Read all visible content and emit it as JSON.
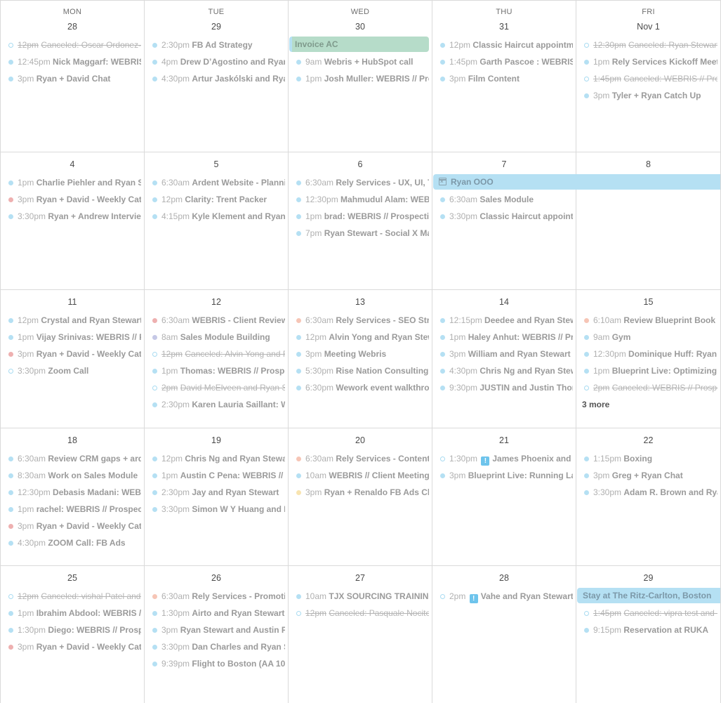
{
  "calendar": {
    "weekdays": [
      "MON",
      "TUE",
      "WED",
      "THU",
      "FRI"
    ],
    "colors": {
      "default_event": "#b5e0f3",
      "red_event": "#eeb0b0",
      "salmon_event": "#f6c5b6",
      "purple_event": "#c5c8e6",
      "yellow_event": "#f8e4b0",
      "allday_green": "#b6dcc9",
      "allday_blue": "#b5e0f3"
    },
    "weeks": [
      {
        "days": [
          {
            "date": "28",
            "events": [
              {
                "time": "12pm",
                "title": "Canceled: Oscar Ordonez-",
                "color": "hollow",
                "canceled": true
              },
              {
                "time": "12:45pm",
                "title": "Nick Maggarf: WEBRIS",
                "color": "blue"
              },
              {
                "time": "3pm",
                "title": "Ryan + David Chat",
                "color": "blue"
              }
            ]
          },
          {
            "date": "29",
            "events": [
              {
                "time": "2:30pm",
                "title": "FB Ad Strategy",
                "color": "blue"
              },
              {
                "time": "4pm",
                "title": "Drew D’Agostino and Ryan Stewart",
                "color": "blue"
              },
              {
                "time": "4:30pm",
                "title": "Artur Jaskólski and Ryan Stewart",
                "color": "blue"
              }
            ]
          },
          {
            "date": "30",
            "allday": {
              "title": "Invoice AC",
              "style": "green"
            },
            "events": [
              {
                "time": "9am",
                "title": "Webris + HubSpot call",
                "color": "blue"
              },
              {
                "time": "1pm",
                "title": "Josh Muller: WEBRIS // Prospective",
                "color": "blue"
              }
            ]
          },
          {
            "date": "31",
            "events": [
              {
                "time": "12pm",
                "title": "Classic Haircut appointment",
                "color": "blue"
              },
              {
                "time": "1:45pm",
                "title": "Garth Pascoe : WEBRIS // Prospective",
                "color": "blue"
              },
              {
                "time": "3pm",
                "title": "Film Content",
                "color": "blue"
              }
            ]
          },
          {
            "date": "Nov 1",
            "events": [
              {
                "time": "12:30pm",
                "title": "Canceled: Ryan Stewart",
                "color": "hollow",
                "canceled": true
              },
              {
                "time": "1pm",
                "title": "Rely Services Kickoff Meeting",
                "color": "blue"
              },
              {
                "time": "1:45pm",
                "title": "Canceled: WEBRIS // Prospective",
                "color": "hollow",
                "canceled": true
              },
              {
                "time": "3pm",
                "title": "Tyler + Ryan Catch Up",
                "color": "blue"
              }
            ]
          }
        ]
      },
      {
        "days": [
          {
            "date": "4",
            "events": [
              {
                "time": "1pm",
                "title": "Charlie Piehler and Ryan Stewart",
                "color": "blue"
              },
              {
                "time": "3pm",
                "title": "Ryan + David - Weekly Catch Up",
                "color": "red"
              },
              {
                "time": "3:30pm",
                "title": "Ryan + Andrew Interview",
                "color": "blue"
              }
            ]
          },
          {
            "date": "5",
            "events": [
              {
                "time": "6:30am",
                "title": "Ardent Website - Planning",
                "color": "blue"
              },
              {
                "time": "12pm",
                "title": "Clarity: Trent Packer",
                "color": "blue"
              },
              {
                "time": "4:15pm",
                "title": "Kyle Klement and Ryan Stewart",
                "color": "blue"
              }
            ]
          },
          {
            "date": "6",
            "events": [
              {
                "time": "6:30am",
                "title": "Rely Services - UX, UI, Tech",
                "color": "blue"
              },
              {
                "time": "12:30pm",
                "title": "Mahmudul Alam: WEBRIS",
                "color": "blue"
              },
              {
                "time": "1pm",
                "title": "brad: WEBRIS // Prospective",
                "color": "blue"
              },
              {
                "time": "7pm",
                "title": "Ryan Stewart - Social X Marketing",
                "color": "blue"
              }
            ]
          },
          {
            "date": "7",
            "allday_span": {
              "title": "Ryan OOO",
              "icon": "calendar-x-icon",
              "style": "blue"
            },
            "events": [
              {
                "time": "6:30am",
                "title": "Sales Module",
                "color": "blue"
              },
              {
                "time": "3:30pm",
                "title": "Classic Haircut appointment",
                "color": "blue"
              }
            ]
          },
          {
            "date": "8",
            "events": []
          }
        ]
      },
      {
        "days": [
          {
            "date": "11",
            "events": [
              {
                "time": "12pm",
                "title": "Crystal and Ryan Stewart",
                "color": "blue"
              },
              {
                "time": "1pm",
                "title": "Vijay Srinivas: WEBRIS // Prospective",
                "color": "blue"
              },
              {
                "time": "3pm",
                "title": "Ryan + David - Weekly Catch Up",
                "color": "red"
              },
              {
                "time": "3:30pm",
                "title": "Zoom Call",
                "color": "hollow"
              }
            ]
          },
          {
            "date": "12",
            "events": [
              {
                "time": "6:30am",
                "title": "WEBRIS - Client Reviews",
                "color": "red"
              },
              {
                "time": "8am",
                "title": "Sales Module Building",
                "color": "purple"
              },
              {
                "time": "12pm",
                "title": "Canceled: Alvin Yong and Ryan Stewart",
                "color": "hollow",
                "canceled": true
              },
              {
                "time": "1pm",
                "title": "Thomas: WEBRIS // Prospective",
                "color": "blue"
              },
              {
                "time": "2pm",
                "title": "David McElveen and Ryan Stewart",
                "color": "hollow",
                "canceled": true
              },
              {
                "time": "2:30pm",
                "title": "Karen Lauria Saillant: WEBRIS",
                "color": "blue"
              }
            ]
          },
          {
            "date": "13",
            "events": [
              {
                "time": "6:30am",
                "title": "Rely Services - SEO Strategy",
                "color": "salmon"
              },
              {
                "time": "12pm",
                "title": "Alvin Yong and Ryan Stewart",
                "color": "blue"
              },
              {
                "time": "3pm",
                "title": "Meeting Webris",
                "color": "blue"
              },
              {
                "time": "5:30pm",
                "title": "Rise Nation Consulting",
                "color": "blue"
              },
              {
                "time": "6:30pm",
                "title": "Wework event walkthrough",
                "color": "blue"
              }
            ]
          },
          {
            "date": "14",
            "events": [
              {
                "time": "12:15pm",
                "title": "Deedee and Ryan Stewart",
                "color": "blue"
              },
              {
                "time": "1pm",
                "title": "Haley Anhut: WEBRIS // Prospective",
                "color": "blue"
              },
              {
                "time": "3pm",
                "title": "William and Ryan Stewart",
                "color": "blue"
              },
              {
                "time": "4:30pm",
                "title": "Chris Ng and Ryan Stewart",
                "color": "blue"
              },
              {
                "time": "9:30pm",
                "title": "JUSTIN and Justin Thomas",
                "color": "blue"
              }
            ]
          },
          {
            "date": "15",
            "more": "3 more",
            "events": [
              {
                "time": "6:10am",
                "title": "Review Blueprint Book",
                "color": "salmon"
              },
              {
                "time": "9am",
                "title": "Gym",
                "color": "blue"
              },
              {
                "time": "12:30pm",
                "title": "Dominique Huff: Ryan Stewart",
                "color": "blue"
              },
              {
                "time": "1pm",
                "title": "Blueprint Live: Optimizing Ins",
                "color": "blue"
              },
              {
                "time": "2pm",
                "title": "Canceled: WEBRIS // Prospective",
                "color": "hollow",
                "canceled": true
              }
            ]
          }
        ]
      },
      {
        "days": [
          {
            "date": "18",
            "events": [
              {
                "time": "6:30am",
                "title": "Review CRM gaps + ardent",
                "color": "blue"
              },
              {
                "time": "8:30am",
                "title": "Work on Sales Module",
                "color": "blue"
              },
              {
                "time": "12:30pm",
                "title": "Debasis Madani: WEBRIS",
                "color": "blue"
              },
              {
                "time": "1pm",
                "title": "rachel: WEBRIS // Prospective",
                "color": "blue"
              },
              {
                "time": "3pm",
                "title": "Ryan + David - Weekly Catch Up",
                "color": "red"
              },
              {
                "time": "4:30pm",
                "title": "ZOOM Call: FB Ads",
                "color": "blue"
              }
            ]
          },
          {
            "date": "19",
            "events": [
              {
                "time": "12pm",
                "title": "Chris Ng and Ryan Stewart",
                "color": "blue"
              },
              {
                "time": "1pm",
                "title": "Austin C Pena: WEBRIS // Prospective",
                "color": "blue"
              },
              {
                "time": "2:30pm",
                "title": "Jay and Ryan Stewart",
                "color": "blue"
              },
              {
                "time": "3:30pm",
                "title": "Simon W Y Huang and Ryan Stewart",
                "color": "blue"
              }
            ]
          },
          {
            "date": "20",
            "events": [
              {
                "time": "6:30am",
                "title": "Rely Services - Content Strategy",
                "color": "salmon"
              },
              {
                "time": "10am",
                "title": "WEBRIS // Client Meeting",
                "color": "blue"
              },
              {
                "time": "3pm",
                "title": "Ryan + Renaldo FB Ads Chat",
                "color": "yellow"
              }
            ]
          },
          {
            "date": "21",
            "events": [
              {
                "time": "1:30pm",
                "title": "James Phoenix and Ryan Stewart",
                "color": "hollow",
                "alert": "!"
              },
              {
                "time": "3pm",
                "title": "Blueprint Live: Running Large",
                "color": "blue"
              }
            ]
          },
          {
            "date": "22",
            "events": [
              {
                "time": "1:15pm",
                "title": "Boxing",
                "color": "blue"
              },
              {
                "time": "3pm",
                "title": "Greg + Ryan Chat",
                "color": "blue"
              },
              {
                "time": "3:30pm",
                "title": "Adam R. Brown and Ryan Stewart",
                "color": "blue"
              }
            ]
          }
        ]
      },
      {
        "days": [
          {
            "date": "25",
            "events": [
              {
                "time": "12pm",
                "title": "Canceled: vishal Patel and Ryan",
                "color": "hollow",
                "canceled": true
              },
              {
                "time": "1pm",
                "title": "Ibrahim Abdool: WEBRIS // Prospective",
                "color": "blue"
              },
              {
                "time": "1:30pm",
                "title": "Diego: WEBRIS // Prospective",
                "color": "blue"
              },
              {
                "time": "3pm",
                "title": "Ryan + David - Weekly Catch Up",
                "color": "red"
              }
            ]
          },
          {
            "date": "26",
            "events": [
              {
                "time": "6:30am",
                "title": "Rely Services - Promotion",
                "color": "salmon"
              },
              {
                "time": "1:30pm",
                "title": "Airto and Ryan Stewart",
                "color": "blue"
              },
              {
                "time": "3pm",
                "title": "Ryan Stewart and Austin Pena",
                "color": "blue"
              },
              {
                "time": "3:30pm",
                "title": "Dan Charles and Ryan Stewart",
                "color": "blue"
              },
              {
                "time": "9:39pm",
                "title": "Flight to Boston (AA 105)",
                "color": "blue"
              }
            ]
          },
          {
            "date": "27",
            "events": [
              {
                "time": "10am",
                "title": "TJX SOURCING TRAINING",
                "color": "blue"
              },
              {
                "time": "12pm",
                "title": "Canceled: Pasquale Nocito",
                "color": "hollow",
                "canceled": true
              }
            ]
          },
          {
            "date": "28",
            "events": [
              {
                "time": "2pm",
                "title": "Vahe and Ryan Stewart",
                "color": "hollow",
                "alert": "!"
              }
            ]
          },
          {
            "date": "29",
            "allday": {
              "title": "Stay at The Ritz-Carlton, Boston",
              "style": "blue-open"
            },
            "events": [
              {
                "time": "1:45pm",
                "title": "Canceled: vipra test and Ryan",
                "color": "hollow",
                "canceled": true
              },
              {
                "time": "9:15pm",
                "title": "Reservation at RUKA",
                "color": "blue"
              }
            ]
          }
        ]
      }
    ]
  }
}
